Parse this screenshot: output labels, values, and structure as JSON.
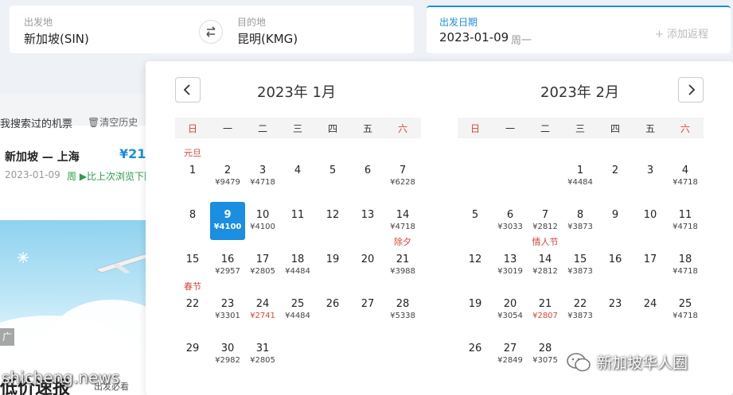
{
  "search": {
    "from_label": "出发地",
    "from_value": "新加坡(SIN)",
    "to_label": "目的地",
    "to_value": "昆明(KMG)",
    "date_label": "出发日期",
    "date_value": "2023-01-09",
    "date_weekday": "周一",
    "add_return": "+ 添加返程"
  },
  "recent": {
    "title": "我搜索过的机票",
    "clear_label": "清空历史",
    "route": "新加坡 — 上海",
    "price": "¥21",
    "date": "2023-01-09",
    "note": "周 ▶比上次浏览下降"
  },
  "banner": {
    "tag": "广告",
    "headline": "低价速报",
    "sub": "出发必看"
  },
  "calendar": {
    "months": [
      {
        "title": "2023年 1月",
        "weekdays": [
          "日",
          "一",
          "二",
          "三",
          "四",
          "五",
          "六"
        ],
        "weeks": [
          [
            {
              "day": "1",
              "price": "",
              "holiday": "元旦"
            },
            {
              "day": "2",
              "price": "¥9479"
            },
            {
              "day": "3",
              "price": "¥4718"
            },
            {
              "day": "4",
              "price": ""
            },
            {
              "day": "5",
              "price": ""
            },
            {
              "day": "6",
              "price": ""
            },
            {
              "day": "7",
              "price": "¥6228"
            }
          ],
          [
            {
              "day": "8",
              "price": ""
            },
            {
              "day": "9",
              "price": "¥4100",
              "selected": true
            },
            {
              "day": "10",
              "price": "¥4100"
            },
            {
              "day": "11",
              "price": ""
            },
            {
              "day": "12",
              "price": ""
            },
            {
              "day": "13",
              "price": ""
            },
            {
              "day": "14",
              "price": "¥4718"
            }
          ],
          [
            {
              "day": "15",
              "price": ""
            },
            {
              "day": "16",
              "price": "¥2957"
            },
            {
              "day": "17",
              "price": "¥2805"
            },
            {
              "day": "18",
              "price": "¥4484"
            },
            {
              "day": "19",
              "price": ""
            },
            {
              "day": "20",
              "price": ""
            },
            {
              "day": "21",
              "price": "¥3988",
              "holiday": "除夕"
            }
          ],
          [
            {
              "day": "22",
              "price": "",
              "holiday": "春节"
            },
            {
              "day": "23",
              "price": "¥3301"
            },
            {
              "day": "24",
              "price": "¥2741",
              "low": true
            },
            {
              "day": "25",
              "price": "¥4484"
            },
            {
              "day": "26",
              "price": ""
            },
            {
              "day": "27",
              "price": ""
            },
            {
              "day": "28",
              "price": "¥5338"
            }
          ],
          [
            {
              "day": "29",
              "price": ""
            },
            {
              "day": "30",
              "price": "¥2982"
            },
            {
              "day": "31",
              "price": "¥2805"
            },
            null,
            null,
            null,
            null
          ]
        ]
      },
      {
        "title": "2023年 2月",
        "weekdays": [
          "日",
          "一",
          "二",
          "三",
          "四",
          "五",
          "六"
        ],
        "weeks": [
          [
            null,
            null,
            null,
            {
              "day": "1",
              "price": "¥4484"
            },
            {
              "day": "2",
              "price": ""
            },
            {
              "day": "3",
              "price": ""
            },
            {
              "day": "4",
              "price": "¥4718"
            }
          ],
          [
            {
              "day": "5",
              "price": ""
            },
            {
              "day": "6",
              "price": "¥3033"
            },
            {
              "day": "7",
              "price": "¥2812"
            },
            {
              "day": "8",
              "price": "¥3873"
            },
            {
              "day": "9",
              "price": ""
            },
            {
              "day": "10",
              "price": ""
            },
            {
              "day": "11",
              "price": "¥4718"
            }
          ],
          [
            {
              "day": "12",
              "price": ""
            },
            {
              "day": "13",
              "price": "¥3019"
            },
            {
              "day": "14",
              "price": "¥2812",
              "holiday": "情人节"
            },
            {
              "day": "15",
              "price": "¥3873"
            },
            {
              "day": "16",
              "price": ""
            },
            {
              "day": "17",
              "price": ""
            },
            {
              "day": "18",
              "price": "¥4718"
            }
          ],
          [
            {
              "day": "19",
              "price": ""
            },
            {
              "day": "20",
              "price": "¥3054"
            },
            {
              "day": "21",
              "price": "¥2807",
              "low": true
            },
            {
              "day": "22",
              "price": "¥3873"
            },
            {
              "day": "23",
              "price": ""
            },
            {
              "day": "24",
              "price": ""
            },
            {
              "day": "25",
              "price": "¥4718"
            }
          ],
          [
            {
              "day": "26",
              "price": ""
            },
            {
              "day": "27",
              "price": "¥2849"
            },
            {
              "day": "28",
              "price": "¥3075"
            },
            null,
            null,
            null,
            null
          ]
        ]
      }
    ]
  },
  "watermarks": {
    "left": "shicheng.news",
    "right": "新加坡华人圈"
  },
  "colors": {
    "accent": "#1a8ee0",
    "holiday": "#d9443a",
    "low_price": "#d9443a",
    "trend_down": "#2a9d4a"
  }
}
